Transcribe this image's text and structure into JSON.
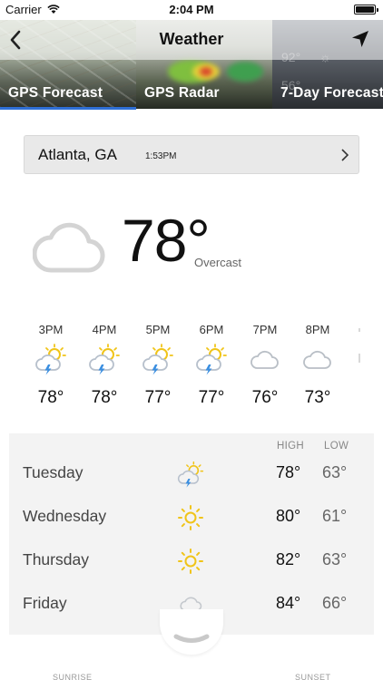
{
  "status_bar": {
    "carrier": "Carrier",
    "time": "2:04 PM"
  },
  "header": {
    "title": "Weather"
  },
  "tabs": [
    {
      "label": "GPS Forecast",
      "selected": true
    },
    {
      "label": "GPS Radar",
      "selected": false
    },
    {
      "label": "7-Day Forecast",
      "selected": false
    }
  ],
  "tab_background_text": {
    "line1": "92°",
    "line2": "56°"
  },
  "accent_color": "#2f6fd6",
  "location": {
    "city": "Atlanta, GA",
    "updated": "1:53PM"
  },
  "current": {
    "temp": "78°",
    "condition": "Overcast",
    "icon": "cloud-icon"
  },
  "hourly": [
    {
      "time": "3PM",
      "temp": "78°",
      "icon": "thunder-sun-icon"
    },
    {
      "time": "4PM",
      "temp": "78°",
      "icon": "thunder-sun-icon"
    },
    {
      "time": "5PM",
      "temp": "77°",
      "icon": "thunder-sun-icon"
    },
    {
      "time": "6PM",
      "temp": "77°",
      "icon": "thunder-sun-icon"
    },
    {
      "time": "7PM",
      "temp": "76°",
      "icon": "cloud-icon"
    },
    {
      "time": "8PM",
      "temp": "73°",
      "icon": "cloud-icon"
    }
  ],
  "daily": {
    "high_label": "HIGH",
    "low_label": "LOW",
    "days": [
      {
        "name": "Tuesday",
        "high": "78°",
        "low": "63°",
        "icon": "thunder-sun-icon"
      },
      {
        "name": "Wednesday",
        "high": "80°",
        "low": "61°",
        "icon": "sun-icon"
      },
      {
        "name": "Thursday",
        "high": "82°",
        "low": "63°",
        "icon": "sun-icon"
      },
      {
        "name": "Friday",
        "high": "84°",
        "low": "66°",
        "icon": "cloud-icon"
      }
    ]
  },
  "footer": {
    "sunrise_label": "SUNRISE",
    "sunset_label": "SUNSET"
  }
}
